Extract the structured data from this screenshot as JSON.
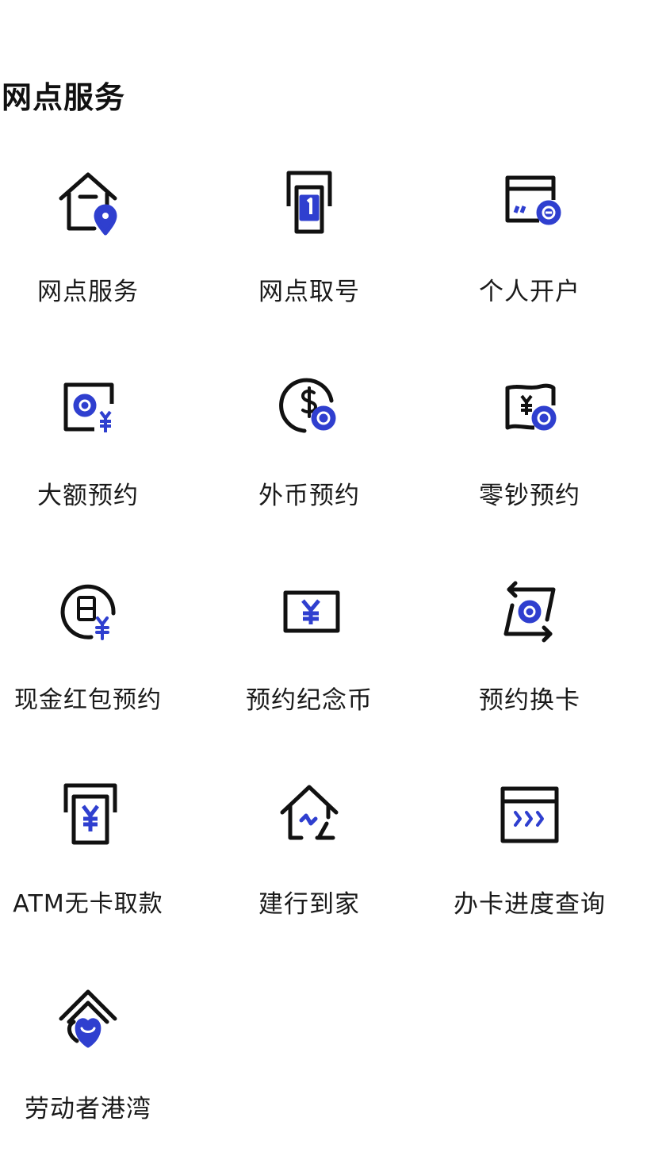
{
  "section": {
    "title": "网点服务"
  },
  "colors": {
    "ink": "#111111",
    "accent": "#2f3fcf"
  },
  "services": [
    {
      "label": "网点服务",
      "icon": "branch-location-icon"
    },
    {
      "label": "网点取号",
      "icon": "queue-ticket-icon"
    },
    {
      "label": "个人开户",
      "icon": "card-add-icon"
    },
    {
      "label": "大额预约",
      "icon": "large-amount-clock-icon"
    },
    {
      "label": "外币预约",
      "icon": "foreign-currency-clock-icon"
    },
    {
      "label": "零钞预约",
      "icon": "small-change-clock-icon"
    },
    {
      "label": "现金红包预约",
      "icon": "cash-envelope-calendar-icon"
    },
    {
      "label": "预约纪念币",
      "icon": "commemorative-coin-icon"
    },
    {
      "label": "预约换卡",
      "icon": "card-exchange-icon"
    },
    {
      "label": "ATM无卡取款",
      "icon": "atm-cardless-icon"
    },
    {
      "label": "建行到家",
      "icon": "home-delivery-icon"
    },
    {
      "label": "办卡进度查询",
      "icon": "card-progress-icon"
    },
    {
      "label": "劳动者港湾",
      "icon": "worker-harbor-icon"
    }
  ]
}
